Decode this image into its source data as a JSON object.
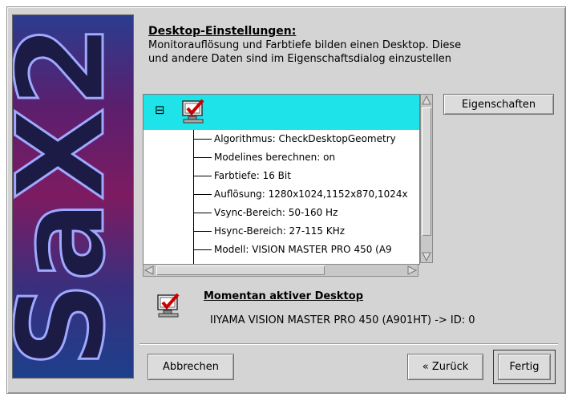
{
  "banner": {
    "logo_text": "SaX2"
  },
  "header": {
    "title": "Desktop-Einstellungen:",
    "description_line1": "Monitorauflösung und Farbtiefe bilden einen Desktop. Diese",
    "description_line2": "und andere Daten sind im Eigenschaftsdialog einzustellen"
  },
  "buttons": {
    "properties": "Eigenschaften",
    "cancel": "Abbrechen",
    "back": "« Zurück",
    "finish": "Fertig"
  },
  "tree": {
    "collapse_symbol": "⊟",
    "items": [
      "Algorithmus: CheckDesktopGeometry",
      "Modelines berechnen: on",
      "Farbtiefe: 16 Bit",
      "Auflösung: 1280x1024,1152x870,1024x",
      "Vsync-Bereich: 50-160 Hz",
      "Hsync-Bereich: 27-115 KHz",
      "Modell: VISION MASTER PRO 450 (A9"
    ]
  },
  "active_desktop": {
    "title": "Momentan aktiver Desktop",
    "value": "IIYAMA VISION MASTER PRO 450 (A901HT) -> ID: 0"
  },
  "colors": {
    "tree_header_bg": "#1ee3e8",
    "window_bg": "#d4d4d4",
    "checkmark": "#cc0000"
  },
  "icons": [
    "monitor-check-icon",
    "collapse-icon",
    "scroll-up-icon",
    "scroll-down-icon",
    "scroll-left-icon",
    "scroll-right-icon"
  ]
}
